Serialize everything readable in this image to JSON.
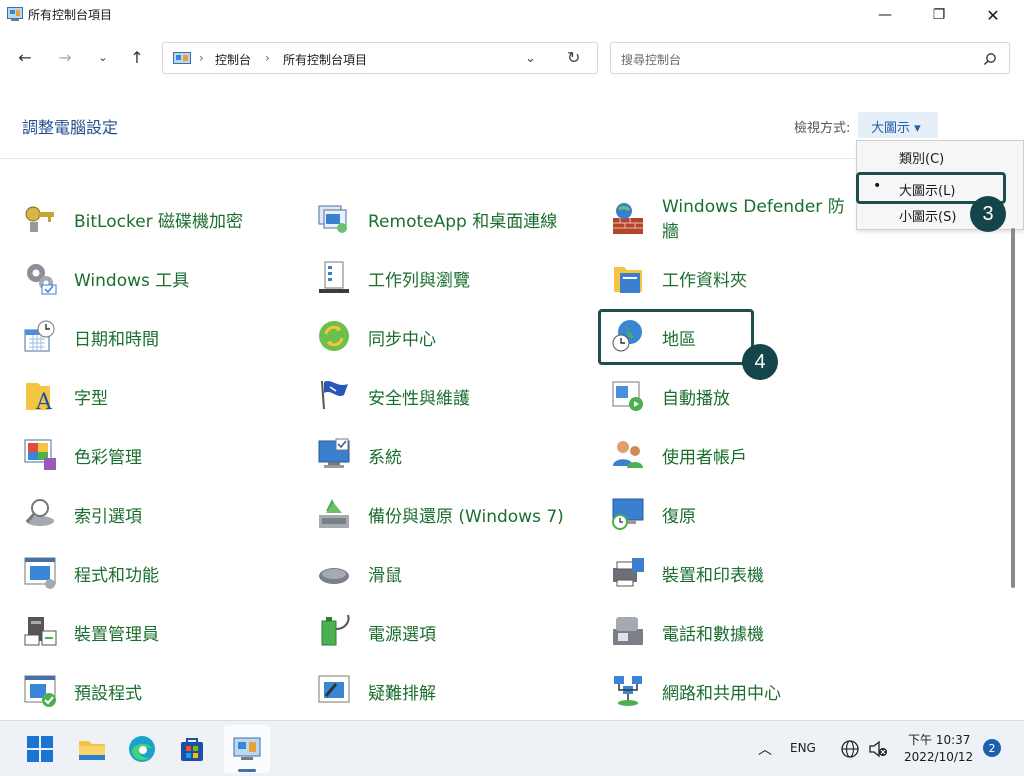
{
  "window": {
    "title": "所有控制台項目"
  },
  "breadcrumb": {
    "part1": "控制台",
    "part2": "所有控制台項目"
  },
  "search": {
    "placeholder": "搜尋控制台"
  },
  "page": {
    "title": "調整電腦設定"
  },
  "view": {
    "label": "檢視方式:",
    "current": "大圖示 ▾"
  },
  "view_menu": {
    "items": [
      "類別(C)",
      "大圖示(L)",
      "小圖示(S)"
    ],
    "selected_marker": "•"
  },
  "steps": {
    "three": "3",
    "four": "4"
  },
  "items": [
    {
      "label": "BitLocker 磁碟機加密",
      "icon": "bitlocker-key-icon"
    },
    {
      "label": "RemoteApp 和桌面連線",
      "icon": "remoteapp-icon"
    },
    {
      "label": "Windows Defender 防",
      "label2": "牆",
      "icon": "firewall-icon"
    },
    {
      "label": "Windows 工具",
      "icon": "windows-tools-icon"
    },
    {
      "label": "工作列與瀏覽",
      "icon": "taskbar-icon"
    },
    {
      "label": "工作資料夾",
      "icon": "work-folders-icon"
    },
    {
      "label": "日期和時間",
      "icon": "date-time-icon"
    },
    {
      "label": "同步中心",
      "icon": "sync-center-icon"
    },
    {
      "label": "地區",
      "icon": "region-globe-icon"
    },
    {
      "label": "字型",
      "icon": "fonts-icon"
    },
    {
      "label": "安全性與維護",
      "icon": "security-flag-icon"
    },
    {
      "label": "自動播放",
      "icon": "autoplay-icon"
    },
    {
      "label": "色彩管理",
      "icon": "color-management-icon"
    },
    {
      "label": "系統",
      "icon": "system-monitor-icon"
    },
    {
      "label": "使用者帳戶",
      "icon": "user-accounts-icon"
    },
    {
      "label": "索引選項",
      "icon": "indexing-icon"
    },
    {
      "label": "備份與還原 (Windows 7)",
      "icon": "backup-restore-icon"
    },
    {
      "label": "復原",
      "icon": "recovery-icon"
    },
    {
      "label": "程式和功能",
      "icon": "programs-features-icon"
    },
    {
      "label": "滑鼠",
      "icon": "mouse-icon"
    },
    {
      "label": "裝置和印表機",
      "icon": "devices-printers-icon"
    },
    {
      "label": "裝置管理員",
      "icon": "device-manager-icon"
    },
    {
      "label": "電源選項",
      "icon": "power-options-icon"
    },
    {
      "label": "電話和數據機",
      "icon": "phone-modem-icon"
    },
    {
      "label": "預設程式",
      "icon": "default-programs-icon"
    },
    {
      "label": "疑難排解",
      "icon": "troubleshooting-icon"
    },
    {
      "label": "網路和共用中心",
      "icon": "network-sharing-icon"
    }
  ],
  "taskbar": {
    "lang": "ENG",
    "time": "下午 10:37",
    "date": "2022/10/12",
    "notifications": "2"
  }
}
